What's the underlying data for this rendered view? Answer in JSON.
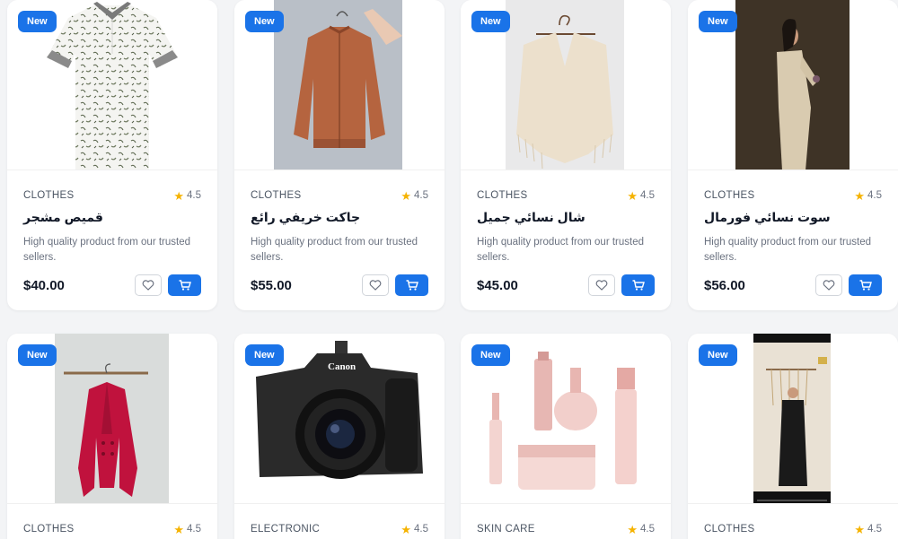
{
  "products": [
    {
      "badge": "New",
      "category": "CLOTHES",
      "rating": "4.5",
      "title": "قميص مشجر",
      "description": "High quality product from our trusted sellers.",
      "price": "$40.00",
      "image": "floral-shirt"
    },
    {
      "badge": "New",
      "category": "CLOTHES",
      "rating": "4.5",
      "title": "جاكت خريفي رائع",
      "description": "High quality product from our trusted sellers.",
      "price": "$55.00",
      "image": "bomber-jacket"
    },
    {
      "badge": "New",
      "category": "CLOTHES",
      "rating": "4.5",
      "title": "شال نسائي جميل",
      "description": "High quality product from our trusted sellers.",
      "price": "$45.00",
      "image": "knit-poncho"
    },
    {
      "badge": "New",
      "category": "CLOTHES",
      "rating": "4.5",
      "title": "سوت نسائي فورمال",
      "description": "High quality product from our trusted sellers.",
      "price": "$56.00",
      "image": "formal-suit"
    },
    {
      "badge": "New",
      "category": "CLOTHES",
      "rating": "4.5",
      "image": "red-blazer"
    },
    {
      "badge": "New",
      "category": "ELECTRONIC",
      "rating": "4.5",
      "image": "canon-camera",
      "image_text": "Canon"
    },
    {
      "badge": "New",
      "category": "SKIN CARE",
      "rating": "4.5",
      "image": "cosmetics-set"
    },
    {
      "badge": "New",
      "category": "CLOTHES",
      "rating": "4.5",
      "image": "abaya-dress"
    }
  ],
  "colors": {
    "accent": "#1a73e8",
    "star": "#f5b301"
  },
  "icons": {
    "rating": "star-icon",
    "wishlist": "heart-icon",
    "cart": "cart-icon"
  }
}
